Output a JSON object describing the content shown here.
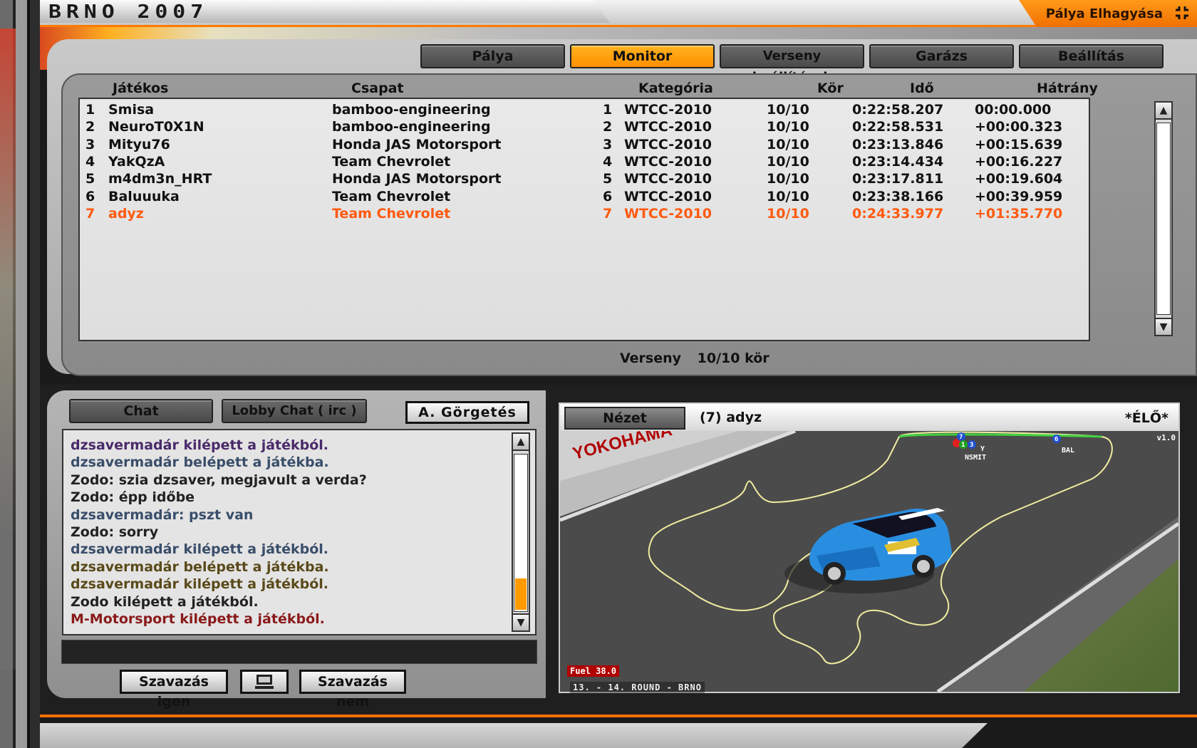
{
  "window": {
    "track_title": "BRNO 2007",
    "leave_label": "Pálya Elhagyása",
    "leave_icon": "fullscreen-exit-icon"
  },
  "tabs": [
    {
      "label": "Pálya",
      "active": false
    },
    {
      "label": "Monitor",
      "active": true
    },
    {
      "label": "Verseny beállítások",
      "active": false
    },
    {
      "label": "Garázs",
      "active": false
    },
    {
      "label": "Beállítás",
      "active": false
    }
  ],
  "results": {
    "columns": {
      "player": "Játékos",
      "team": "Csapat",
      "category": "Kategória",
      "laps": "Kör",
      "time": "Idő",
      "gap": "Hátrány"
    },
    "rows": [
      {
        "pos": "1",
        "player": "Smisa",
        "team": "bamboo-engineering",
        "cat_pos": "1",
        "category": "WTCC-2010",
        "laps": "10/10",
        "time": "0:22:58.207",
        "gap": "00:00.000"
      },
      {
        "pos": "2",
        "player": "NeuroT0X1N",
        "team": "bamboo-engineering",
        "cat_pos": "2",
        "category": "WTCC-2010",
        "laps": "10/10",
        "time": "0:22:58.531",
        "gap": "+00:00.323"
      },
      {
        "pos": "3",
        "player": "Mityu76",
        "team": "Honda JAS Motorsport",
        "cat_pos": "3",
        "category": "WTCC-2010",
        "laps": "10/10",
        "time": "0:23:13.846",
        "gap": "+00:15.639"
      },
      {
        "pos": "4",
        "player": "YakQzA",
        "team": "Team Chevrolet",
        "cat_pos": "4",
        "category": "WTCC-2010",
        "laps": "10/10",
        "time": "0:23:14.434",
        "gap": "+00:16.227"
      },
      {
        "pos": "5",
        "player": "m4dm3n_HRT",
        "team": "Honda JAS Motorsport",
        "cat_pos": "5",
        "category": "WTCC-2010",
        "laps": "10/10",
        "time": "0:23:17.811",
        "gap": "+00:19.604"
      },
      {
        "pos": "6",
        "player": "Baluuuka",
        "team": "Team Chevrolet",
        "cat_pos": "6",
        "category": "WTCC-2010",
        "laps": "10/10",
        "time": "0:23:38.166",
        "gap": "+00:39.959"
      },
      {
        "pos": "7",
        "player": "adyz",
        "team": "Team Chevrolet",
        "cat_pos": "7",
        "category": "WTCC-2010",
        "laps": "10/10",
        "time": "0:24:33.977",
        "gap": "+01:35.770",
        "highlight": true
      }
    ],
    "status_label": "Verseny",
    "status_value": "10/10 kör"
  },
  "chat": {
    "tabs": [
      "Chat",
      "Lobby Chat ( irc )"
    ],
    "autoscroll_label": "A. Görgetés",
    "lines": [
      {
        "text": "dzsavermadár kilépett a játékból.",
        "color": "#4a2a6a"
      },
      {
        "text": "dzsavermadár belépett a játékba.",
        "color": "#3a4e6a"
      },
      {
        "text": "Zodo: szia dzsaver, megjavult a verda?",
        "color": "#222222"
      },
      {
        "text": "Zodo: épp időbe",
        "color": "#222222"
      },
      {
        "text": "dzsavermadár: pszt van",
        "color": "#3a4e6a"
      },
      {
        "text": "Zodo: sorry",
        "color": "#222222"
      },
      {
        "text": "dzsavermadár kilépett a játékból.",
        "color": "#3a4e6a"
      },
      {
        "text": "dzsavermadár belépett a játékba.",
        "color": "#5a4a1a"
      },
      {
        "text": "dzsavermadár kilépett a játékból.",
        "color": "#5a4a1a"
      },
      {
        "text": "Zodo kilépett a játékból.",
        "color": "#222222"
      },
      {
        "text": "M-Motorsport kilépett a játékból.",
        "color": "#8a1a1a"
      }
    ],
    "input_value": "",
    "vote_yes": "Szavazás igen",
    "vote_no": "Szavazás nem",
    "vote_icon": "monitor-icon"
  },
  "view": {
    "button_label": "Nézet",
    "driver": "(7) adyz",
    "live": "*ÉLŐ*",
    "version": "v1.0",
    "fuel": "Fuel 38.0",
    "round": "13. - 14. ROUND - BRNO",
    "map_labels": {
      "a": "Y",
      "b": "NSMIT",
      "c": "BAL"
    },
    "map_markers": [
      "7",
      "1",
      "3",
      "6"
    ]
  },
  "colors": {
    "accent": "#ff8c00",
    "highlight_row": "#ff5a10"
  }
}
